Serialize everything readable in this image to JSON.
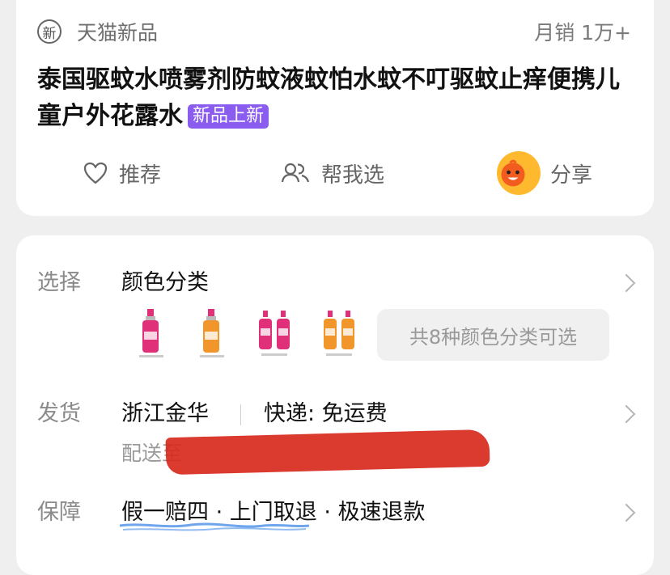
{
  "header": {
    "badge_icon_text": "新",
    "brand": "天猫新品",
    "sales": "月销 1万+"
  },
  "product": {
    "title": "泰国驱蚊水喷雾剂防蚊液蚊怕水蚊不叮驱蚊止痒便携儿童户外花露水",
    "tag": "新品上新"
  },
  "actions": {
    "recommend": "推荐",
    "help_choose": "帮我选",
    "share": "分享"
  },
  "options": {
    "select_label": "选择",
    "select_value": "颜色分类",
    "thumbnails": [
      {
        "name": "pink-single",
        "color": "#e0307a"
      },
      {
        "name": "orange-single",
        "color": "#f0962a"
      },
      {
        "name": "pink-double",
        "color": "#e0307a"
      },
      {
        "name": "orange-double",
        "color": "#f0962a"
      }
    ],
    "all_colors_button": "共8种颜色分类可选",
    "ship_label": "发货",
    "ship_origin": "浙江金华",
    "ship_courier": "快递: 免运费",
    "ship_dest_prefix": "配送至",
    "guarantee_label": "保障",
    "guarantee_value": "假一赔四 · 上门取退 · 极速退款"
  },
  "colors": {
    "tag_purple": "#8a5cf0",
    "redaction": "#d8291d",
    "mascot": "#ffb92e"
  }
}
